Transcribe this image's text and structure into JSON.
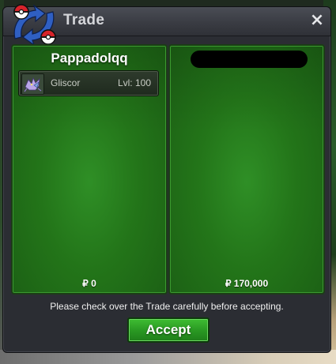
{
  "window": {
    "title": "Trade",
    "close_glyph": "×"
  },
  "left_panel": {
    "player_name": "Pappadolqq",
    "items": [
      {
        "name": "Gliscor",
        "level_label": "Lvl: 100",
        "sprite_icon": "gliscor-sprite-icon"
      }
    ],
    "money": "₽ 0"
  },
  "right_panel": {
    "player_name_redacted": true,
    "money": "₽ 170,000"
  },
  "footer": {
    "notice": "Please check over the Trade carefully before accepting.",
    "accept_label": "Accept"
  },
  "colors": {
    "panel_green": "#237519",
    "accept_green": "#2a9a23",
    "window_bg": "#2b2d33"
  }
}
